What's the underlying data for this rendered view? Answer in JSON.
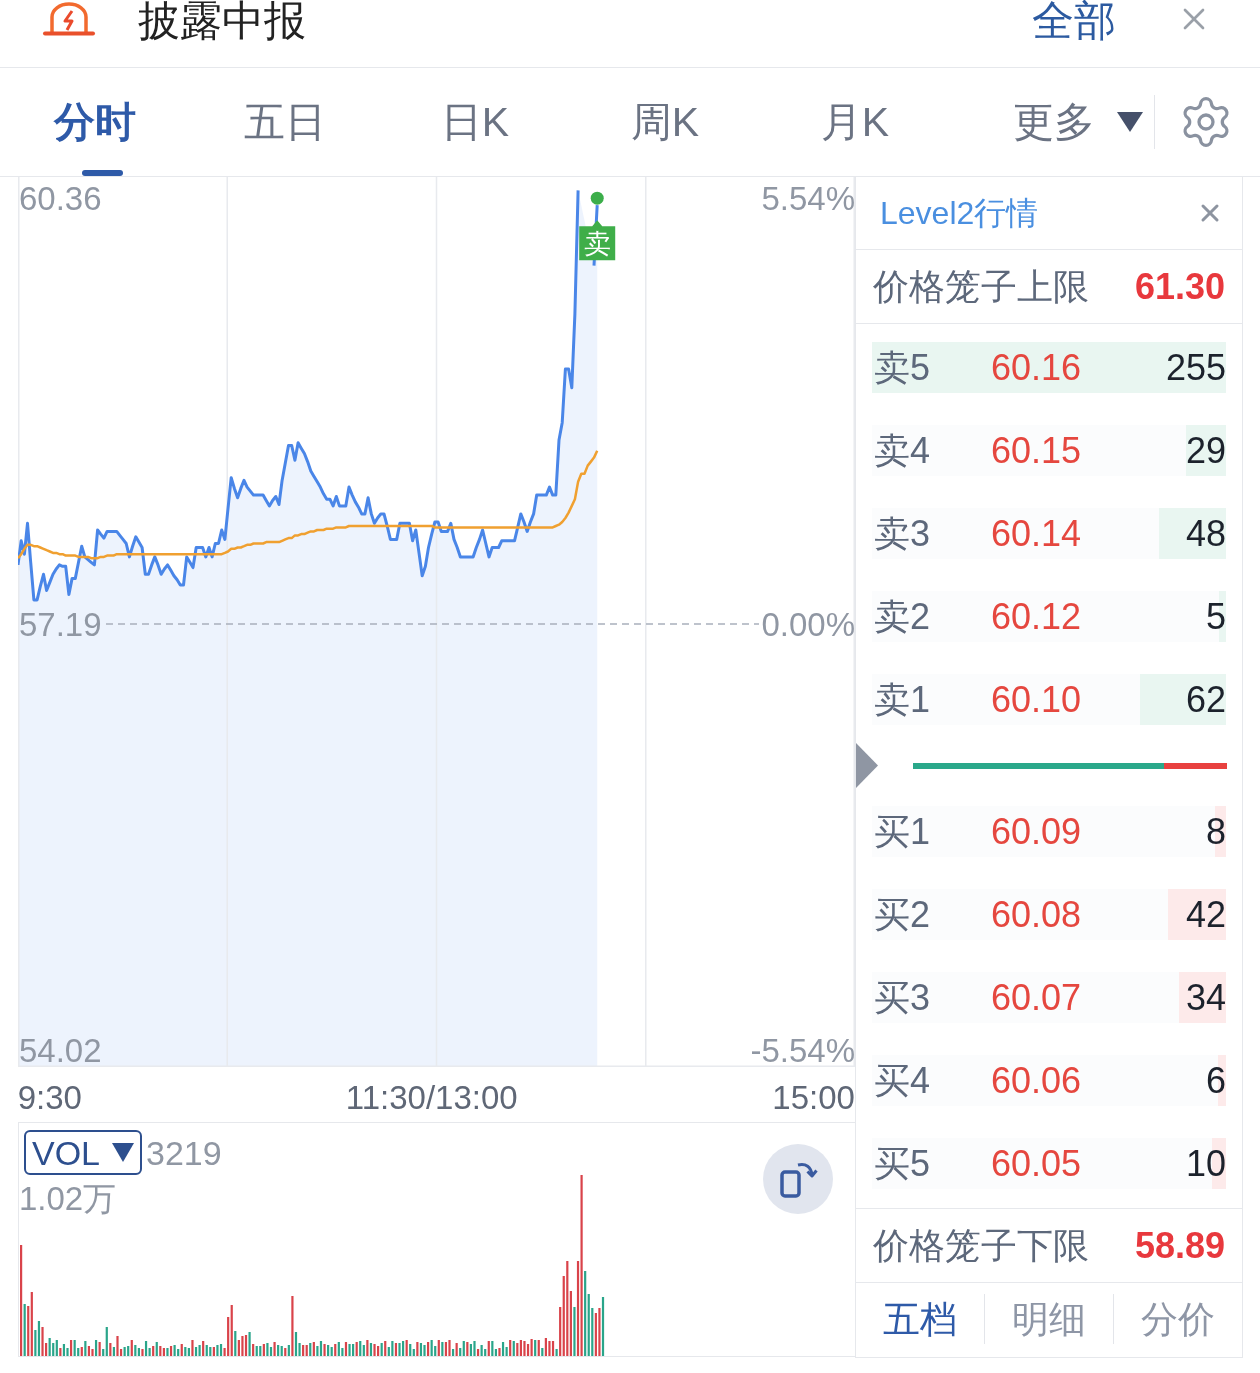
{
  "header": {
    "title": "披露中报",
    "action": "全部"
  },
  "period_tabs": [
    {
      "label": "分时",
      "selected": true
    },
    {
      "label": "五日",
      "selected": false
    },
    {
      "label": "日K",
      "selected": false
    },
    {
      "label": "周K",
      "selected": false
    },
    {
      "label": "月K",
      "selected": false
    }
  ],
  "more_tab": {
    "label": "更多"
  },
  "price_chart": {
    "chart_data": {
      "type": "line",
      "categories": [
        null,
        null,
        null,
        null,
        null,
        null,
        null,
        null,
        null,
        null,
        "9:30",
        null,
        null,
        null,
        null,
        null,
        null,
        null,
        null,
        null,
        null,
        null,
        null,
        null,
        null,
        null,
        null,
        null,
        null,
        null,
        null,
        null,
        null,
        null,
        null,
        null,
        null,
        null,
        null,
        null,
        null,
        null,
        null,
        null,
        null,
        null,
        null,
        null,
        null,
        null,
        null,
        null,
        null,
        null,
        null,
        null,
        null,
        null,
        null,
        null,
        null,
        null,
        null,
        null,
        null,
        null,
        null,
        null,
        null,
        null,
        null,
        null,
        null,
        null,
        null,
        null,
        null,
        null,
        null,
        null,
        null,
        null,
        null,
        null,
        null,
        null,
        null,
        null,
        null,
        null,
        null,
        null,
        null,
        null,
        null,
        null,
        null,
        null,
        null,
        null,
        null,
        null,
        null,
        null,
        null,
        null,
        null,
        null,
        null,
        null,
        null,
        null,
        null,
        null,
        null,
        null,
        null,
        null,
        null,
        null,
        null,
        null,
        null,
        null,
        null,
        null,
        null,
        null,
        null,
        null,
        "11:30/13:00",
        null,
        null,
        null,
        null,
        null,
        null,
        null,
        null,
        null,
        null,
        null,
        null,
        null,
        null,
        null,
        null,
        null,
        null,
        null,
        null,
        null,
        null,
        null,
        null,
        null,
        null,
        null,
        null,
        null,
        null,
        null,
        null,
        null,
        null,
        null,
        null,
        null,
        null,
        null,
        null,
        null,
        null,
        null,
        null,
        null,
        null,
        null,
        null,
        null,
        null,
        null,
        null,
        null,
        null,
        null,
        null,
        null,
        null,
        null,
        null,
        null,
        null,
        null,
        null,
        null,
        null,
        null,
        null,
        null,
        null,
        null,
        null,
        null,
        null,
        null,
        null,
        null,
        null,
        null,
        null,
        null,
        null,
        null,
        null,
        null,
        null,
        null,
        null,
        null,
        null,
        null,
        null,
        null,
        null,
        null,
        null,
        null,
        null,
        null,
        null,
        null,
        null,
        null,
        null,
        null,
        null,
        null,
        null,
        null,
        null,
        null,
        null,
        null,
        null,
        null,
        null,
        null,
        null,
        null,
        "15:00",
        null,
        null,
        null,
        null,
        null,
        null,
        null,
        null,
        null,
        null,
        null,
        null,
        null
      ],
      "series": [
        {
          "type": "area",
          "color": "#4a86e8",
          "values": [
            57.63,
            57.81,
            57.71,
            57.94,
            57.65,
            57.37,
            57.37,
            57.47,
            57.56,
            57.44,
            57.5,
            57.56,
            57.6,
            57.63,
            57.62,
            57.62,
            57.41,
            57.53,
            57.53,
            57.65,
            57.77,
            57.69,
            57.67,
            57.65,
            57.63,
            57.89,
            57.86,
            57.83,
            57.88,
            57.88,
            57.88,
            57.88,
            57.85,
            57.82,
            57.79,
            57.69,
            57.77,
            57.84,
            57.8,
            57.76,
            57.56,
            57.56,
            57.63,
            57.69,
            57.63,
            57.56,
            57.6,
            57.63,
            57.59,
            57.55,
            57.52,
            57.48,
            57.48,
            57.69,
            57.65,
            57.61,
            57.76,
            57.76,
            57.76,
            57.69,
            57.76,
            57.69,
            57.79,
            57.79,
            57.89,
            57.82,
            58.05,
            58.28,
            58.2,
            58.13,
            58.2,
            58.26,
            58.21,
            58.18,
            58.15,
            58.15,
            58.15,
            58.15,
            58.11,
            58.07,
            58.11,
            58.14,
            58.08,
            58.26,
            58.39,
            58.52,
            58.52,
            58.41,
            58.54,
            58.5,
            58.46,
            58.4,
            58.33,
            58.29,
            58.25,
            58.21,
            58.16,
            58.12,
            58.12,
            58.07,
            58.14,
            58.07,
            58.07,
            58.07,
            58.21,
            58.15,
            58.1,
            58.06,
            58.01,
            58.01,
            58.13,
            58.01,
            57.94,
            57.98,
            58.01,
            58.01,
            57.92,
            57.82,
            57.82,
            57.82,
            57.94,
            57.94,
            57.94,
            57.94,
            57.81,
            57.89,
            57.72,
            57.55,
            57.62,
            57.76,
            57.86,
            57.95,
            57.95,
            57.88,
            57.88,
            57.88,
            57.94,
            57.82,
            57.76,
            57.69,
            57.69,
            57.69,
            57.69,
            57.69,
            57.76,
            57.82,
            57.89,
            57.79,
            57.69,
            57.76,
            57.76,
            57.76,
            57.81,
            57.81,
            57.81,
            57.81,
            57.81,
            57.91,
            58.01,
            57.95,
            57.88,
            57.95,
            58.01,
            58.15,
            58.15,
            58.15,
            58.15,
            58.21,
            58.15,
            58.15,
            58.56,
            58.69,
            59.09,
            59.09,
            58.95,
            59.5,
            60.42,
            null,
            null,
            null,
            null,
            59.86,
            60.31,
            null,
            null,
            null,
            null,
            null,
            null,
            null,
            null,
            null,
            null,
            null,
            null,
            null,
            null,
            null,
            null,
            null,
            null,
            null,
            null,
            null,
            null,
            null,
            null,
            null,
            null,
            null,
            null,
            null,
            null,
            null,
            null,
            null,
            null,
            null,
            null,
            null,
            null,
            null,
            null,
            null,
            null,
            null,
            null,
            null,
            null,
            null,
            null,
            null,
            null,
            null,
            null,
            null,
            null,
            null,
            null,
            null,
            null,
            null,
            null,
            null,
            null,
            null,
            null,
            null,
            null,
            null,
            null,
            null,
            null,
            null,
            null,
            null,
            null,
            null,
            null,
            null,
            null,
            null,
            null,
            null
          ]
        },
        {
          "color": "#f0a030",
          "values": [
            57.68,
            57.71,
            57.75,
            57.78,
            57.78,
            57.77,
            57.77,
            57.76,
            57.75,
            57.74,
            57.73,
            57.72,
            57.72,
            57.71,
            57.71,
            57.7,
            57.7,
            57.7,
            57.7,
            57.69,
            57.69,
            57.69,
            57.69,
            57.68,
            57.68,
            57.68,
            57.69,
            57.69,
            57.7,
            57.7,
            57.7,
            57.71,
            57.71,
            57.71,
            57.71,
            57.71,
            57.71,
            57.71,
            57.71,
            57.71,
            57.71,
            57.71,
            57.71,
            57.71,
            57.71,
            57.71,
            57.71,
            57.71,
            57.71,
            57.71,
            57.71,
            57.71,
            57.71,
            57.71,
            57.71,
            57.71,
            57.71,
            57.71,
            57.71,
            57.71,
            57.71,
            57.71,
            57.71,
            57.71,
            57.71,
            57.72,
            57.73,
            57.75,
            57.75,
            57.76,
            57.76,
            57.77,
            57.78,
            57.78,
            57.79,
            57.79,
            57.79,
            57.79,
            57.8,
            57.8,
            57.8,
            57.8,
            57.8,
            57.81,
            57.82,
            57.83,
            57.83,
            57.85,
            57.85,
            57.86,
            57.86,
            57.87,
            57.88,
            57.88,
            57.89,
            57.89,
            57.89,
            57.9,
            57.9,
            57.9,
            57.91,
            57.91,
            57.91,
            57.91,
            57.92,
            57.92,
            57.92,
            57.92,
            57.92,
            57.92,
            57.92,
            57.92,
            57.92,
            57.92,
            57.92,
            57.92,
            57.92,
            57.92,
            57.92,
            57.92,
            57.92,
            57.92,
            57.92,
            57.92,
            57.92,
            57.92,
            57.92,
            57.92,
            57.92,
            57.92,
            57.92,
            57.91,
            57.91,
            57.91,
            57.91,
            57.91,
            57.91,
            57.91,
            57.91,
            57.91,
            57.91,
            57.91,
            57.91,
            57.91,
            57.91,
            57.91,
            57.91,
            57.91,
            57.91,
            57.91,
            57.91,
            57.91,
            57.91,
            57.91,
            57.91,
            57.91,
            57.91,
            57.91,
            57.91,
            57.91,
            57.91,
            57.91,
            57.91,
            57.91,
            57.91,
            57.91,
            57.91,
            57.91,
            57.91,
            57.92,
            57.93,
            57.95,
            57.98,
            58.02,
            58.07,
            58.12,
            58.25,
            58.31,
            58.31,
            58.37,
            58.4,
            58.43,
            58.48,
            null,
            null,
            null,
            null,
            null,
            null,
            null,
            null,
            null,
            null,
            null,
            null,
            null,
            null,
            null,
            null,
            null,
            null,
            null,
            null,
            null,
            null,
            null,
            null,
            null,
            null,
            null,
            null,
            null,
            null,
            null,
            null,
            null,
            null,
            null,
            null,
            null,
            null,
            null,
            null,
            null,
            null,
            null,
            null,
            null,
            null,
            null,
            null,
            null,
            null,
            null,
            null,
            null,
            null,
            null,
            null,
            null,
            null,
            null,
            null,
            null,
            null,
            null,
            null,
            null,
            null,
            null,
            null,
            null,
            null,
            null,
            null,
            null,
            null,
            null,
            null,
            null,
            null,
            null,
            null,
            null
          ]
        }
      ],
      "ylim": [
        53.89,
        60.52
      ],
      "yticks": [
        {
          "value": 60.36,
          "label": "60.36"
        },
        {
          "value": 54.02,
          "label": "54.02"
        }
      ],
      "ref_lines": [
        {
          "axis": "y",
          "value": 57.19,
          "label": "57.19"
        }
      ],
      "annotations": [
        {
          "y": 60.31,
          "text": "卖"
        }
      ]
    },
    "percent_labels": [
      "5.54%",
      "0.00%",
      "-5.54%"
    ]
  },
  "volume_panel": {
    "indicator": "VOL",
    "current_value": "3219",
    "max_label": "1.02万"
  },
  "level2_panel": {
    "title": "Level2行情",
    "upper_limit": {
      "label": "价格笼子上限",
      "value": "61.30"
    },
    "sell_orders": [
      {
        "label": "卖5",
        "price": "60.16",
        "volume": "255",
        "level": 1.0
      },
      {
        "label": "卖4",
        "price": "60.15",
        "volume": "29",
        "level": 0.114
      },
      {
        "label": "卖3",
        "price": "60.14",
        "volume": "48",
        "level": 0.188
      },
      {
        "label": "卖2",
        "price": "60.12",
        "volume": "5",
        "level": 0.02
      },
      {
        "label": "卖1",
        "price": "60.10",
        "volume": "62",
        "level": 0.243
      }
    ],
    "order_ratio": {
      "level": 0.8
    },
    "buy_orders": [
      {
        "label": "买1",
        "price": "60.09",
        "volume": "8",
        "level": 0.031
      },
      {
        "label": "买2",
        "price": "60.08",
        "volume": "42",
        "level": 0.165
      },
      {
        "label": "买3",
        "price": "60.07",
        "volume": "34",
        "level": 0.133
      },
      {
        "label": "买4",
        "price": "60.06",
        "volume": "6",
        "level": 0.024
      },
      {
        "label": "买5",
        "price": "60.05",
        "volume": "10",
        "level": 0.039
      }
    ],
    "lower_limit": {
      "label": "价格笼子下限",
      "value": "58.89"
    },
    "tabs": [
      {
        "label": "五档",
        "selected": true
      },
      {
        "label": "明细",
        "selected": false
      },
      {
        "label": "分价",
        "selected": false
      }
    ]
  }
}
